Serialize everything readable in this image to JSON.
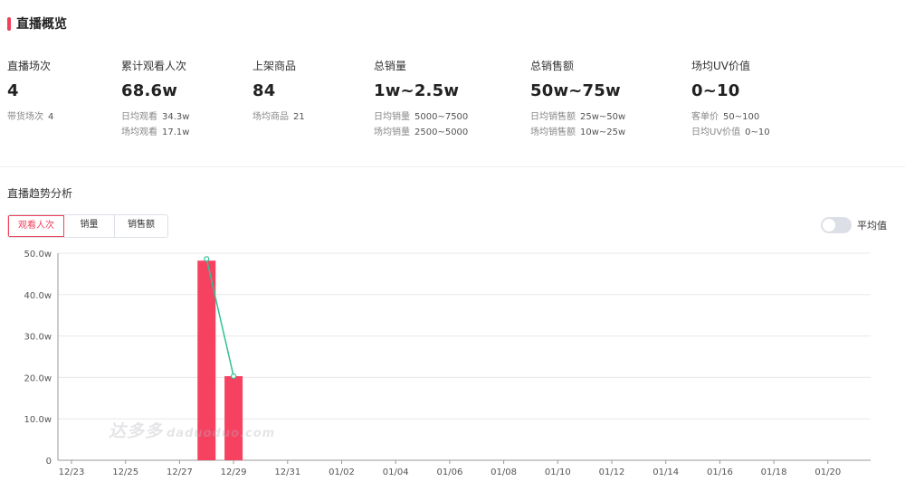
{
  "overview": {
    "title": "直播概览",
    "accent_color": "#f0415a"
  },
  "stats": [
    {
      "label": "直播场次",
      "value": "4",
      "subs": [
        {
          "k": "带货场次",
          "v": "4"
        }
      ]
    },
    {
      "label": "累计观看人次",
      "value": "68.6w",
      "subs": [
        {
          "k": "日均观看",
          "v": "34.3w"
        },
        {
          "k": "场均观看",
          "v": "17.1w"
        }
      ]
    },
    {
      "label": "上架商品",
      "value": "84",
      "subs": [
        {
          "k": "场均商品",
          "v": "21"
        }
      ]
    },
    {
      "label": "总销量",
      "value": "1w~2.5w",
      "subs": [
        {
          "k": "日均销量",
          "v": "5000~7500"
        },
        {
          "k": "场均销量",
          "v": "2500~5000"
        }
      ]
    },
    {
      "label": "总销售额",
      "value": "50w~75w",
      "subs": [
        {
          "k": "日均销售额",
          "v": "25w~50w"
        },
        {
          "k": "场均销售额",
          "v": "10w~25w"
        }
      ]
    },
    {
      "label": "场均UV价值",
      "value": "0~10",
      "subs": [
        {
          "k": "客单价",
          "v": "50~100"
        },
        {
          "k": "日均UV价值",
          "v": "0~10"
        }
      ]
    }
  ],
  "trend": {
    "title": "直播趋势分析",
    "tabs": [
      "观看人次",
      "销量",
      "销售额"
    ],
    "active_tab": 0,
    "toggle_label": "平均值",
    "toggle_on": false
  },
  "watermark": {
    "brand": "达多多",
    "url": "daduoduo.com"
  },
  "chart_data": {
    "type": "bar",
    "x_ticks": [
      "12/23",
      "12/25",
      "12/27",
      "12/29",
      "12/31",
      "01/02",
      "01/04",
      "01/06",
      "01/08",
      "01/10",
      "01/12",
      "01/14",
      "01/16",
      "01/18",
      "01/20"
    ],
    "y_ticks": [
      "0",
      "10.0w",
      "20.0w",
      "30.0w",
      "40.0w",
      "50.0w"
    ],
    "ylim": [
      0,
      50
    ],
    "grid": true,
    "series": [
      {
        "type": "bar",
        "color": "#f74161",
        "points": [
          {
            "x": "12/28",
            "y": 48.2
          },
          {
            "x": "12/29",
            "y": 20.3
          }
        ]
      },
      {
        "type": "line",
        "color": "#2fc293",
        "points": [
          {
            "x": "12/28",
            "y": 48.6
          },
          {
            "x": "12/29",
            "y": 20.3
          }
        ]
      }
    ]
  }
}
